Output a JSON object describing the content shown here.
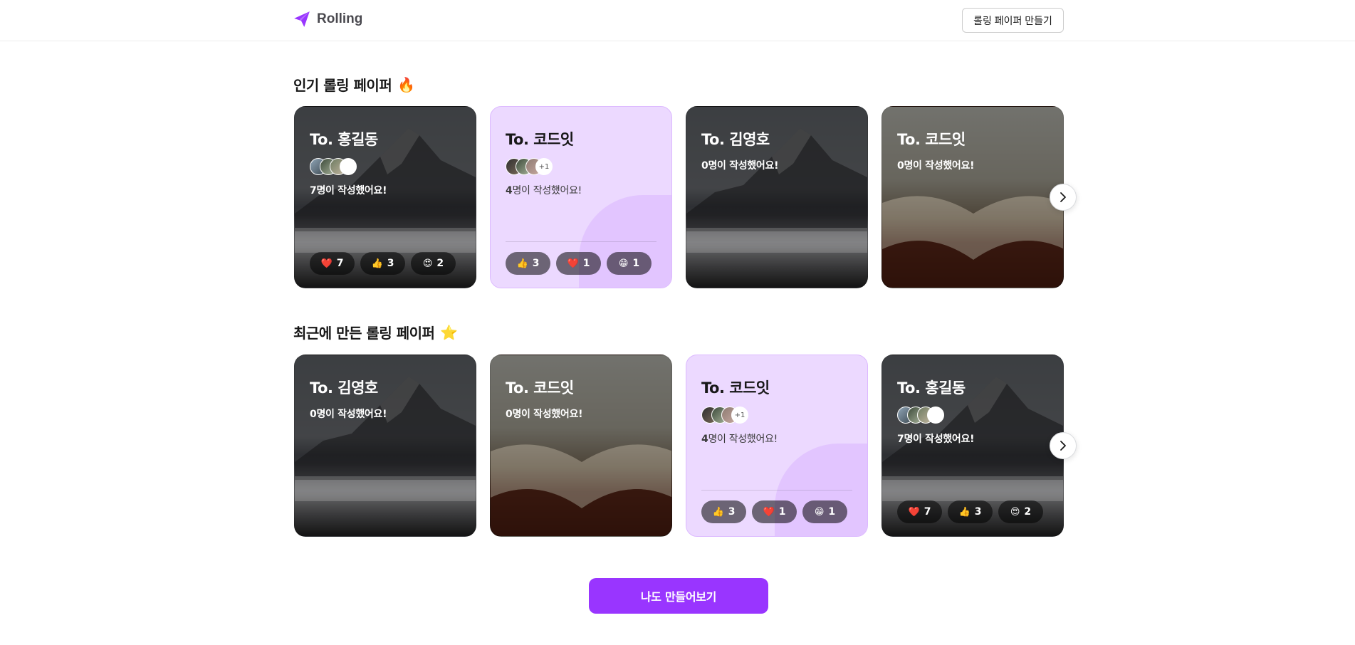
{
  "header": {
    "logo_text": "Rolling",
    "make_button": "롤링 페이퍼 만들기"
  },
  "popular": {
    "title": "인기 롤링 페이퍼",
    "title_emoji": "🔥",
    "cards": [
      {
        "to": "To. 홍길동",
        "count": "7",
        "count_suffix": "명이 작성했어요!",
        "theme": "mountain",
        "reactions": [
          {
            "emoji": "❤️",
            "count": "7"
          },
          {
            "emoji": "👍",
            "count": "3"
          },
          {
            "emoji": "😍",
            "count": "2"
          }
        ]
      },
      {
        "to": "To. 코드잇",
        "count": "4",
        "count_suffix": "명이 작성했어요!",
        "theme": "purple",
        "more": "+1",
        "reactions": [
          {
            "emoji": "👍",
            "count": "3"
          },
          {
            "emoji": "❤️",
            "count": "1"
          },
          {
            "emoji": "😁",
            "count": "1"
          }
        ]
      },
      {
        "to": "To. 김영호",
        "count": "0",
        "count_suffix": "명이 작성했어요!",
        "theme": "mountain"
      },
      {
        "to": "To. 코드잇",
        "count": "0",
        "count_suffix": "명이 작성했어요!",
        "theme": "book"
      }
    ]
  },
  "recent": {
    "title": "최근에 만든 롤링 페이퍼",
    "title_emoji": "⭐",
    "cards": [
      {
        "to": "To. 김영호",
        "count": "0",
        "count_suffix": "명이 작성했어요!",
        "theme": "mountain"
      },
      {
        "to": "To. 코드잇",
        "count": "0",
        "count_suffix": "명이 작성했어요!",
        "theme": "book"
      },
      {
        "to": "To. 코드잇",
        "count": "4",
        "count_suffix": "명이 작성했어요!",
        "theme": "purple",
        "more": "+1",
        "reactions": [
          {
            "emoji": "👍",
            "count": "3"
          },
          {
            "emoji": "❤️",
            "count": "1"
          },
          {
            "emoji": "😁",
            "count": "1"
          }
        ]
      },
      {
        "to": "To. 홍길동",
        "count": "7",
        "count_suffix": "명이 작성했어요!",
        "theme": "mountain",
        "reactions": [
          {
            "emoji": "❤️",
            "count": "7"
          },
          {
            "emoji": "👍",
            "count": "3"
          },
          {
            "emoji": "😍",
            "count": "2"
          }
        ]
      }
    ]
  },
  "cta_label": "나도 만들어보기",
  "colors": {
    "brand": "#9935ff",
    "purple_card": "#ecd9ff"
  }
}
